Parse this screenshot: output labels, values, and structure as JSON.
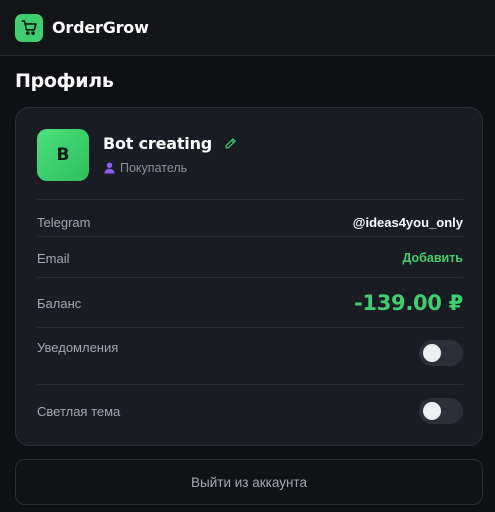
{
  "app": {
    "title": "OrderGrow",
    "logo_icon": "shopping-cart-icon",
    "accent_color": "#3ecf6e"
  },
  "page": {
    "title": "Профиль"
  },
  "profile": {
    "avatar_letter": "B",
    "name": "Bot creating",
    "edit_icon": "pencil-icon",
    "role_icon": "user-icon",
    "role": "Покупатель"
  },
  "fields": {
    "telegram": {
      "label": "Telegram",
      "value": "@ideas4you_only"
    },
    "email": {
      "label": "Email",
      "action": "Добавить"
    },
    "balance": {
      "label": "Баланс",
      "value": "-139.00 ₽"
    },
    "notifications": {
      "label": "Уведомления",
      "enabled": false
    },
    "light_theme": {
      "label": "Светлая тема",
      "enabled": false
    }
  },
  "logout": {
    "label": "Выйти из аккаунта"
  }
}
